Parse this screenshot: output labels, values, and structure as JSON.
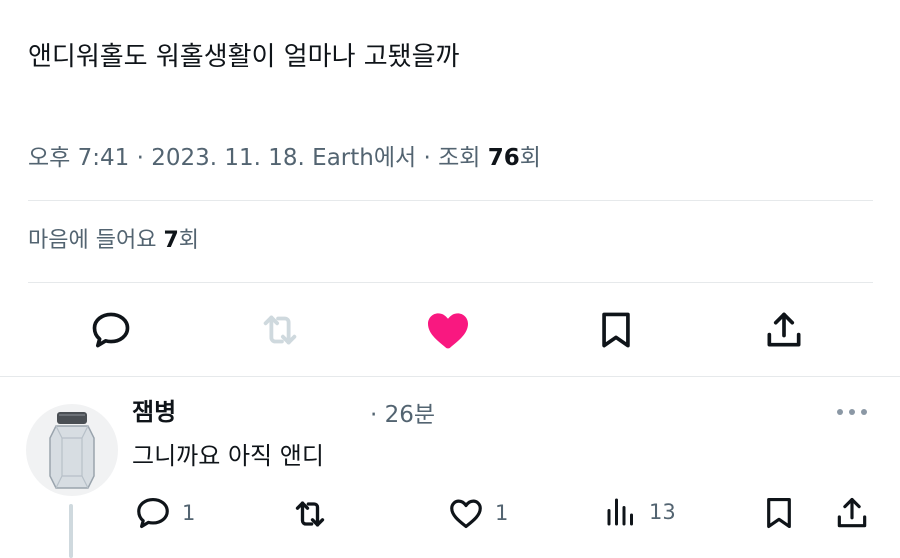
{
  "tweet": {
    "text": "앤디워홀도 워홀생활이 얼마나 고됐을까",
    "time": "오후 7:41",
    "date": "2023. 11. 18.",
    "source": "Earth에서",
    "views_label": "조회",
    "views_count": "76",
    "views_unit": "회",
    "likes_label": "마음에 들어요",
    "likes_count": "7",
    "likes_unit": "회"
  },
  "actions": {
    "reply_icon": "speech-bubble-icon",
    "retweet_icon": "retweet-icon",
    "like_icon": "heart-filled-icon",
    "bookmark_icon": "bookmark-icon",
    "share_icon": "share-icon"
  },
  "reply": {
    "author_name": "잼병",
    "time": "· 26분",
    "text": "그니까요 아직 앤디",
    "reply_count": "1",
    "like_count": "1",
    "view_count": "13"
  },
  "colors": {
    "text": "#0f1419",
    "secondary": "#536471",
    "like_active": "#f91880",
    "retweet_disabled": "#cfd9de",
    "divider": "#e6e9eb"
  }
}
